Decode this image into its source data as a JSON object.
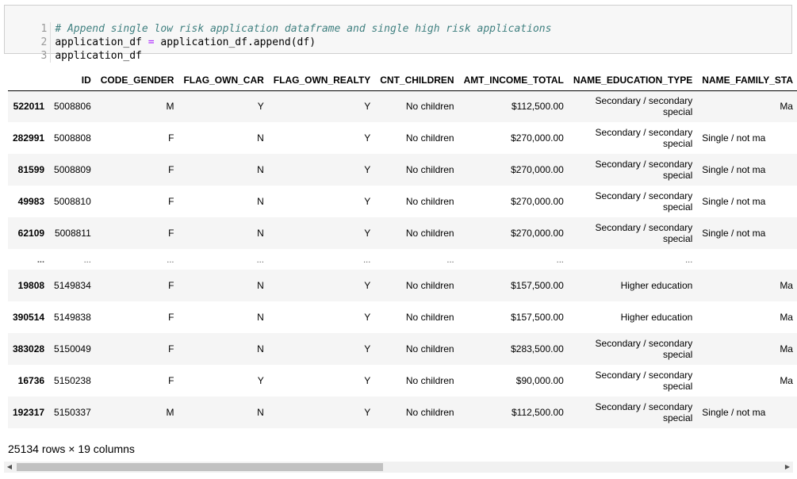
{
  "code": {
    "lines": [
      {
        "num": "1",
        "comment": "# Append single low risk application dataframe and single high risk applications"
      },
      {
        "num": "2",
        "lhs": "application_df",
        "op": "=",
        "rhs": "application_df.append(df)"
      },
      {
        "num": "3",
        "text": "application_df"
      }
    ]
  },
  "table": {
    "columns": [
      "",
      "ID",
      "CODE_GENDER",
      "FLAG_OWN_CAR",
      "FLAG_OWN_REALTY",
      "CNT_CHILDREN",
      "AMT_INCOME_TOTAL",
      "NAME_EDUCATION_TYPE",
      "NAME_FAMILY_STA"
    ],
    "rows": [
      {
        "index": "522011",
        "cells": [
          "5008806",
          "M",
          "Y",
          "Y",
          "No children",
          "$112,500.00",
          "Secondary / secondary special",
          "Ma"
        ]
      },
      {
        "index": "282991",
        "cells": [
          "5008808",
          "F",
          "N",
          "Y",
          "No children",
          "$270,000.00",
          "Secondary / secondary special",
          "Single / not ma"
        ]
      },
      {
        "index": "81599",
        "cells": [
          "5008809",
          "F",
          "N",
          "Y",
          "No children",
          "$270,000.00",
          "Secondary / secondary special",
          "Single / not ma"
        ]
      },
      {
        "index": "49983",
        "cells": [
          "5008810",
          "F",
          "N",
          "Y",
          "No children",
          "$270,000.00",
          "Secondary / secondary special",
          "Single / not ma"
        ]
      },
      {
        "index": "62109",
        "cells": [
          "5008811",
          "F",
          "N",
          "Y",
          "No children",
          "$270,000.00",
          "Secondary / secondary special",
          "Single / not ma"
        ]
      },
      {
        "index": "...",
        "ellipsis": true,
        "cells": [
          "...",
          "...",
          "...",
          "...",
          "...",
          "...",
          "...",
          ""
        ]
      },
      {
        "index": "19808",
        "cells": [
          "5149834",
          "F",
          "N",
          "Y",
          "No children",
          "$157,500.00",
          "Higher education",
          "Ma"
        ]
      },
      {
        "index": "390514",
        "cells": [
          "5149838",
          "F",
          "N",
          "Y",
          "No children",
          "$157,500.00",
          "Higher education",
          "Ma"
        ]
      },
      {
        "index": "383028",
        "cells": [
          "5150049",
          "F",
          "N",
          "Y",
          "No children",
          "$283,500.00",
          "Secondary / secondary special",
          "Ma"
        ]
      },
      {
        "index": "16736",
        "cells": [
          "5150238",
          "F",
          "Y",
          "Y",
          "No children",
          "$90,000.00",
          "Secondary / secondary special",
          "Ma"
        ]
      },
      {
        "index": "192317",
        "cells": [
          "5150337",
          "M",
          "N",
          "Y",
          "No children",
          "$112,500.00",
          "Secondary / secondary special",
          "Single / not ma"
        ]
      }
    ]
  },
  "shape_info": "25134 rows × 19 columns",
  "scrollbar": {
    "left_arrow": "◀",
    "right_arrow": "▶"
  }
}
